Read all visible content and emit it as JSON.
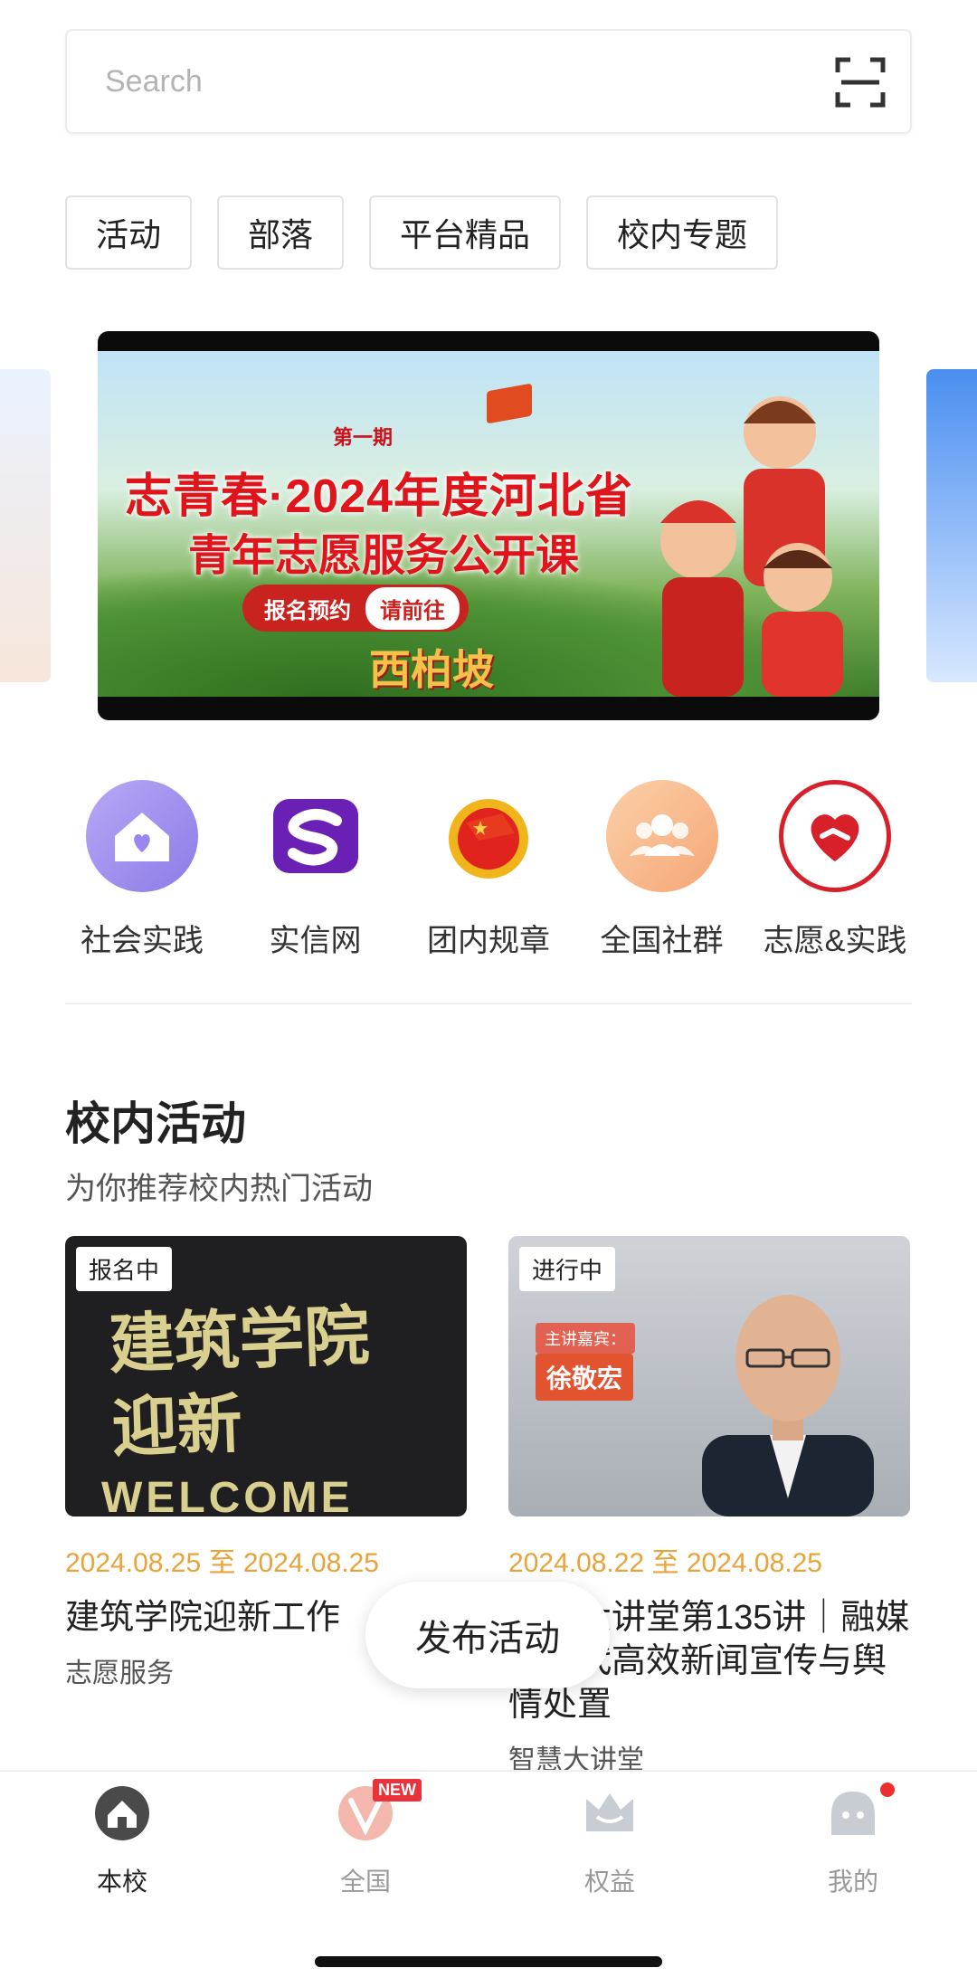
{
  "search": {
    "placeholder": "Search"
  },
  "categories": [
    "活动",
    "部落",
    "平台精品",
    "校内专题"
  ],
  "banner": {
    "issue": "第一期",
    "title_line1": "志青春·2024年度河北省",
    "title_line2": "青年志愿服务公开课",
    "button_label": "报名预约",
    "button_sub": "请前往",
    "slogan": "西柏坡"
  },
  "quick_links": [
    {
      "label": "社会实践",
      "icon": "house-heart-icon"
    },
    {
      "label": "实信网",
      "icon": "s-logo-icon"
    },
    {
      "label": "团内规章",
      "icon": "league-emblem-icon"
    },
    {
      "label": "全国社群",
      "icon": "group-icon"
    },
    {
      "label": "志愿&实践",
      "icon": "volunteer-heart-icon"
    }
  ],
  "section": {
    "title": "校内活动",
    "subtitle": "为你推荐校内热门活动"
  },
  "activities": [
    {
      "status": "报名中",
      "image_text_line1": "建筑学院",
      "image_text_line2": "迎新",
      "image_text_line3": "WELCOME",
      "date": "2024.08.25 至 2024.08.25",
      "title": "建筑学院迎新工作",
      "tag": "志愿服务"
    },
    {
      "status": "进行中",
      "image_label": "主讲嘉宾：",
      "image_name": "徐敬宏",
      "date": "2024.08.22 至 2024.08.25",
      "title": "智慧大讲堂第135讲｜融媒体时代高效新闻宣传与舆情处置",
      "tag": "智慧大讲堂"
    }
  ],
  "fab": {
    "label": "发布活动"
  },
  "tabs": [
    {
      "label": "本校",
      "icon": "home-icon",
      "active": true
    },
    {
      "label": "全国",
      "icon": "v-logo-icon",
      "badge": "NEW"
    },
    {
      "label": "权益",
      "icon": "crown-icon"
    },
    {
      "label": "我的",
      "icon": "profile-icon"
    }
  ],
  "colors": {
    "accent_date": "#e8a33a",
    "badge_red": "#e8333a",
    "text_primary": "#222222"
  }
}
